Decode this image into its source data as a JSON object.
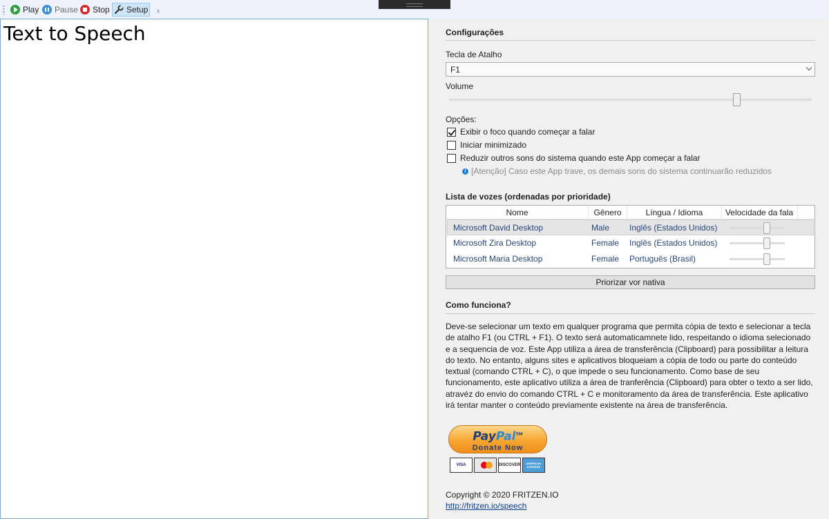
{
  "toolbar": {
    "play_label": "Play",
    "pause_label": "Pause",
    "stop_label": "Stop",
    "setup_label": "Setup",
    "overflow_glyph": "⩡"
  },
  "editor": {
    "text": "Text to Speech"
  },
  "settings": {
    "title": "Configurações",
    "hotkey_label": "Tecla de Atalho",
    "hotkey_value": "F1",
    "volume_label": "Volume",
    "volume_fraction": 0.8,
    "options_label": "Opções:",
    "options": [
      {
        "label": "Exibir o foco quando começar a falar",
        "checked": true
      },
      {
        "label": "Iniciar minimizado",
        "checked": false
      },
      {
        "label": "Reduzir outros sons do sistema quando este App começar a falar",
        "checked": false
      }
    ],
    "warning_note": "[Atenção] Caso este App trave, os demais sons do sistema continuarão reduzidos"
  },
  "voices": {
    "title": "Lista de vozes (ordenadas por prioridade)",
    "columns": [
      "Nome",
      "Gênero",
      "Língua / Idioma",
      "Velocidade da fala"
    ],
    "rows": [
      {
        "name": "Microsoft David Desktop",
        "gender": "Male",
        "language": "Inglês (Estados Unidos)",
        "speed_fraction": 0.7,
        "selected": true
      },
      {
        "name": "Microsoft Zira Desktop",
        "gender": "Female",
        "language": "Inglês (Estados Unidos)",
        "speed_fraction": 0.7,
        "selected": false
      },
      {
        "name": "Microsoft Maria Desktop",
        "gender": "Female",
        "language": "Português (Brasil)",
        "speed_fraction": 0.7,
        "selected": false
      }
    ],
    "prioritize_button": "Priorizar vor nativa"
  },
  "how": {
    "title": "Como funciona?",
    "description": "Deve-se selecionar um texto em qualquer programa que permita cópia de texto e selecionar a tecla de atalho F1 (ou CTRL + F1). O texto será automaticamnete lido, respeitando o idioma selecionado e a sequencia de voz. Este App utiliza a área de transferência (Clipboard) para possibilitar a leitura do texto. No entanto, alguns sites e aplicativos bloqueiam a cópia de todo ou parte do conteúdo textual (comando CTRL + C), o que impede o seu funcionamento. Como base de seu funcionamento, este aplicativo utiliza a área de tranferência (Clipboard) para obter o texto a ser lido, atravéz do envio do comando CTRL + C e monitoramento da área de transferência. Este aplicativo irá tentar manter o conteúdo previamente existente na área de transferência."
  },
  "donate": {
    "brand_pay": "Pay",
    "brand_pal": "Pal",
    "tm": "TM",
    "subtitle": "Donate Now",
    "cards": [
      "VISA",
      "MasterCard",
      "DISCOVER",
      "AMERICAN EXPRESS"
    ]
  },
  "footer": {
    "copyright": "Copyright © 2020 FRITZEN.IO",
    "link": "http://fritzen.io/speech"
  }
}
